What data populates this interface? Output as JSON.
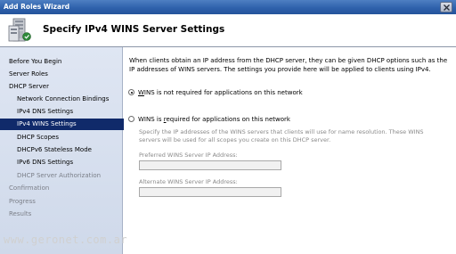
{
  "window": {
    "title": "Add Roles Wizard",
    "close_icon": "close-icon"
  },
  "header": {
    "title": "Specify IPv4 WINS Server Settings",
    "icon": "server-icon"
  },
  "nav": {
    "items": [
      {
        "label": "Before You Begin",
        "level": 0,
        "state": "normal"
      },
      {
        "label": "Server Roles",
        "level": 0,
        "state": "normal"
      },
      {
        "label": "DHCP Server",
        "level": 0,
        "state": "normal"
      },
      {
        "label": "Network Connection Bindings",
        "level": 1,
        "state": "normal"
      },
      {
        "label": "IPv4 DNS Settings",
        "level": 1,
        "state": "normal"
      },
      {
        "label": "IPv4 WINS Settings",
        "level": 1,
        "state": "selected"
      },
      {
        "label": "DHCP Scopes",
        "level": 1,
        "state": "normal"
      },
      {
        "label": "DHCPv6 Stateless Mode",
        "level": 1,
        "state": "normal"
      },
      {
        "label": "IPv6 DNS Settings",
        "level": 1,
        "state": "normal"
      },
      {
        "label": "DHCP Server Authorization",
        "level": 1,
        "state": "disabled"
      },
      {
        "label": "Confirmation",
        "level": 0,
        "state": "disabled"
      },
      {
        "label": "Progress",
        "level": 0,
        "state": "disabled"
      },
      {
        "label": "Results",
        "level": 0,
        "state": "disabled"
      }
    ]
  },
  "content": {
    "intro": "When clients obtain an IP address from the DHCP server, they can be given DHCP options such as the IP addresses of WINS servers. The settings you provide here will be applied to clients using IPv4.",
    "option_not_required": {
      "accel": "W",
      "rest": "INS is not required for applications on this network",
      "checked": true
    },
    "option_required": {
      "pre": "WINS is ",
      "accel": "r",
      "rest": "equired for applications on this network",
      "checked": false
    },
    "required_description": "Specify the IP addresses of the WINS servers that clients will use for name resolution. These WINS servers will be used for all scopes you create on this DHCP server.",
    "preferred_label": "Preferred WINS Server IP Address:",
    "preferred_value": "",
    "alternate_label": "Alternate WINS Server IP Address:",
    "alternate_value": ""
  },
  "watermark": "www.geronet.com.ar",
  "colors": {
    "titlebar": "#2f62ac",
    "nav_bg": "#d7e0f0",
    "nav_selected": "#102a6a"
  }
}
